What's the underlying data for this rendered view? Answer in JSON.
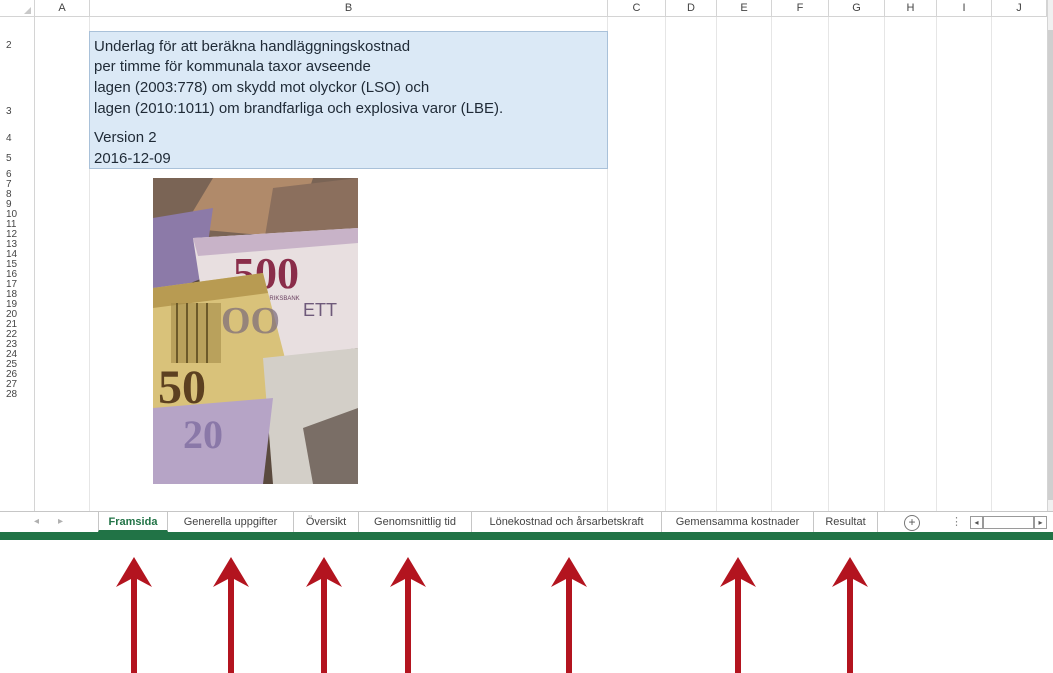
{
  "sheet": {
    "columns": [
      "A",
      "B",
      "C",
      "D",
      "E",
      "F",
      "G",
      "H",
      "I",
      "J"
    ],
    "rows": [
      "2",
      "3",
      "4",
      "5",
      "6",
      "7",
      "8",
      "9",
      "10",
      "11",
      "12",
      "13",
      "14",
      "15",
      "16",
      "17",
      "18",
      "19",
      "20",
      "21",
      "22",
      "23",
      "24",
      "25",
      "26",
      "27",
      "28"
    ]
  },
  "info": {
    "line1": "Underlag för att beräkna handläggningskostnad",
    "line2": "per timme för kommunala taxor avseende",
    "line3": "lagen (2003:778) om skydd mot olyckor (LSO) och",
    "line4": "lagen (2010:1011) om brandfarliga och explosiva varor (LBE).",
    "version": "Version 2",
    "date": "2016-12-09"
  },
  "image": {
    "banknote_500": "500",
    "banknote_riksbank": "SVERIGES RIKSBANK",
    "banknote_ett": "ETT",
    "banknote_50": "50",
    "banknote_20": "20",
    "banknote_oo": "OO"
  },
  "tabs": [
    {
      "label": "Framsida",
      "active": true
    },
    {
      "label": "Generella uppgifter",
      "active": false
    },
    {
      "label": "Översikt",
      "active": false
    },
    {
      "label": "Genomsnittlig tid",
      "active": false
    },
    {
      "label": "Lönekostnad och årsarbetskraft",
      "active": false
    },
    {
      "label": "Gemensamma kostnader",
      "active": false
    },
    {
      "label": "Resultat",
      "active": false
    }
  ],
  "tabbar": {
    "add_symbol": "+",
    "nav_prev": "◂",
    "nav_next": "▸",
    "scroll_left": "◂",
    "scroll_right": "▸",
    "dots": "⋮"
  },
  "colors": {
    "accent": "#217346",
    "arrow": "#b3141f",
    "info_bg": "#dbe9f6"
  }
}
